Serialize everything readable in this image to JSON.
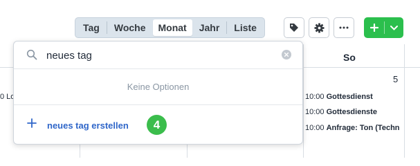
{
  "toolbar": {
    "views": [
      {
        "label": "Tag",
        "active": false
      },
      {
        "label": "Woche",
        "active": false
      },
      {
        "label": "Monat",
        "active": true
      },
      {
        "label": "Jahr",
        "active": false
      },
      {
        "label": "Liste",
        "active": false
      }
    ],
    "icons": {
      "tag": "tag-icon",
      "settings": "gear-icon",
      "more": "more-icon",
      "add": "plus-icon",
      "caret": "chevron-down-icon"
    },
    "accent_color": "#2bbf4d"
  },
  "calendar": {
    "header_day": "So",
    "day_number": "5",
    "clipped_event": "0 Lo",
    "events": [
      {
        "time": "10:00",
        "title": "Gottesdienst"
      },
      {
        "time": "10:00",
        "title": "Gottesdienste"
      },
      {
        "time": "10:00",
        "title": "Anfrage: Ton (Techn"
      }
    ]
  },
  "popup": {
    "search_value": "neues tag",
    "no_options": "Keine Optionen",
    "create_label": "neues tag erstellen",
    "badge": "4",
    "link_color": "#2f66c9"
  }
}
